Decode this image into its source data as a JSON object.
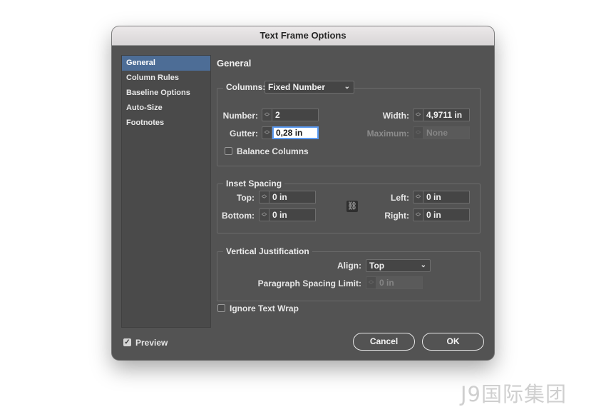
{
  "window": {
    "title": "Text Frame Options"
  },
  "sidebar": {
    "items": [
      {
        "label": "General"
      },
      {
        "label": "Column Rules"
      },
      {
        "label": "Baseline Options"
      },
      {
        "label": "Auto-Size"
      },
      {
        "label": "Footnotes"
      }
    ]
  },
  "main": {
    "section_title": "General",
    "columns": {
      "label": "Columns:",
      "type_value": "Fixed Number",
      "number_label": "Number:",
      "number_value": "2",
      "gutter_label": "Gutter:",
      "gutter_value": "0,28 in",
      "width_label": "Width:",
      "width_value": "4,9711 in",
      "maximum_label": "Maximum:",
      "maximum_value": "None",
      "balance_label": "Balance Columns"
    },
    "inset": {
      "title": "Inset Spacing",
      "top_label": "Top:",
      "top_value": "0 in",
      "bottom_label": "Bottom:",
      "bottom_value": "0 in",
      "left_label": "Left:",
      "left_value": "0 in",
      "right_label": "Right:",
      "right_value": "0 in"
    },
    "vertical": {
      "title": "Vertical Justification",
      "align_label": "Align:",
      "align_value": "Top",
      "psl_label": "Paragraph Spacing Limit:",
      "psl_value": "0 in"
    },
    "ignore_wrap_label": "Ignore Text Wrap"
  },
  "footer": {
    "preview_label": "Preview",
    "cancel_label": "Cancel",
    "ok_label": "OK"
  },
  "watermark": "J9国际集团",
  "colors": {
    "dialog_bg": "#535353",
    "selected": "#4d6d96",
    "focus": "#5b9bf3"
  }
}
